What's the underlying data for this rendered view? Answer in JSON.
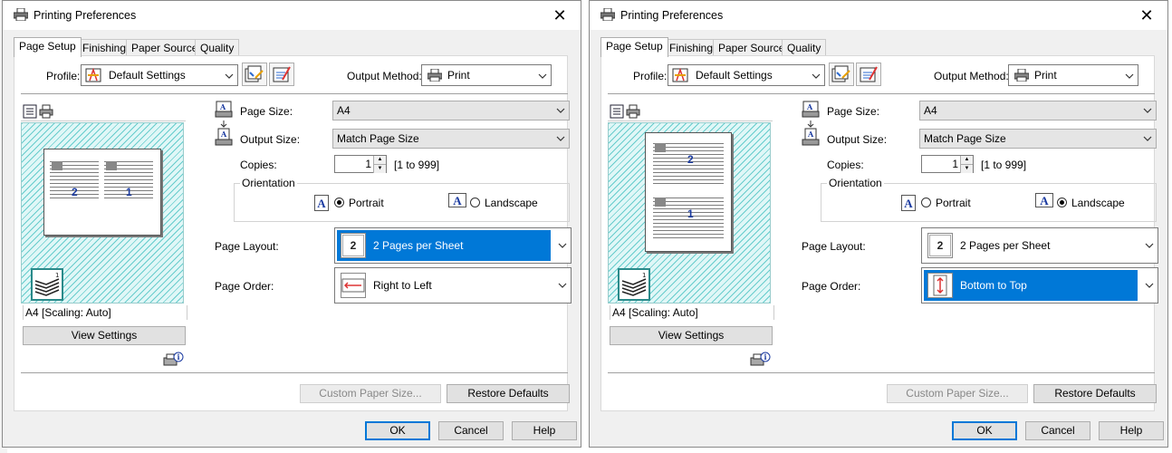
{
  "dialogs": {
    "left": {
      "title": "Printing Preferences",
      "tabs": [
        "Page Setup",
        "Finishing",
        "Paper Source",
        "Quality"
      ],
      "profile_label": "Profile:",
      "profile_value": "Default Settings",
      "output_method_label": "Output Method:",
      "output_method_value": "Print",
      "page_size_label": "Page Size:",
      "page_size_value": "A4",
      "output_size_label": "Output Size:",
      "output_size_value": "Match Page Size",
      "copies_label": "Copies:",
      "copies_value": "1",
      "copies_range": "[1 to 999]",
      "orientation_label": "Orientation",
      "portrait_label": "Portrait",
      "landscape_label": "Landscape",
      "orientation_selected": "portrait",
      "page_layout_label": "Page Layout:",
      "page_layout_value": "2 Pages per Sheet",
      "page_layout_icon_text": "2",
      "page_order_label": "Page Order:",
      "page_order_value": "Right to Left",
      "highlighted_field": "page_layout",
      "scaling_label": "A4 [Scaling: Auto]",
      "view_settings_label": "View Settings",
      "custom_paper_size_label": "Custom Paper Size...",
      "restore_defaults_label": "Restore Defaults",
      "ok_label": "OK",
      "cancel_label": "Cancel",
      "help_label": "Help",
      "preview_pages": [
        "2",
        "1"
      ]
    },
    "right": {
      "title": "Printing Preferences",
      "tabs": [
        "Page Setup",
        "Finishing",
        "Paper Source",
        "Quality"
      ],
      "profile_label": "Profile:",
      "profile_value": "Default Settings",
      "output_method_label": "Output Method:",
      "output_method_value": "Print",
      "page_size_label": "Page Size:",
      "page_size_value": "A4",
      "output_size_label": "Output Size:",
      "output_size_value": "Match Page Size",
      "copies_label": "Copies:",
      "copies_value": "1",
      "copies_range": "[1 to 999]",
      "orientation_label": "Orientation",
      "portrait_label": "Portrait",
      "landscape_label": "Landscape",
      "orientation_selected": "landscape",
      "page_layout_label": "Page Layout:",
      "page_layout_value": "2 Pages per Sheet",
      "page_layout_icon_text": "2",
      "page_order_label": "Page Order:",
      "page_order_value": "Bottom to Top",
      "highlighted_field": "page_order",
      "scaling_label": "A4 [Scaling: Auto]",
      "view_settings_label": "View Settings",
      "custom_paper_size_label": "Custom Paper Size...",
      "restore_defaults_label": "Restore Defaults",
      "ok_label": "OK",
      "cancel_label": "Cancel",
      "help_label": "Help",
      "preview_pages": [
        "2",
        "1"
      ]
    }
  },
  "colors": {
    "accent": "#0078d7",
    "preview_hatch": "#66cccc",
    "page_number": "#1a3aa0"
  },
  "icons": [
    "printer-icon",
    "close-icon",
    "profile-icon",
    "profile-edit-icon",
    "profile-view-icon",
    "print-icon",
    "chevron-down-icon",
    "page-size-icon",
    "output-size-icon",
    "orientation-a-icon",
    "stack-icon",
    "info-icon",
    "layout-2up-icon",
    "order-right-to-left-icon",
    "order-bottom-to-top-icon"
  ]
}
